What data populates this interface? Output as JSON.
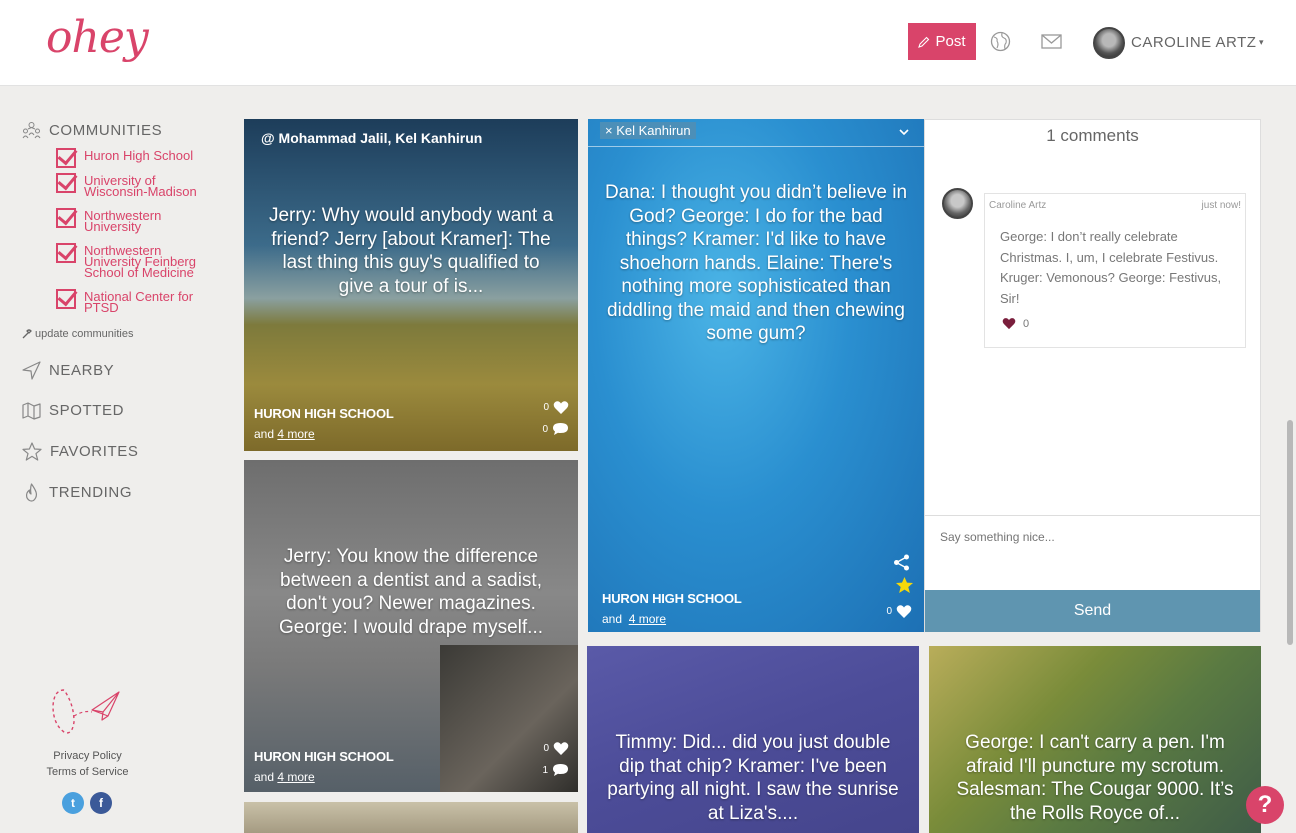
{
  "header": {
    "logo_text": "ohey",
    "post_label": "Post",
    "user_name": "CAROLINE ARTZ",
    "user_caret": "▾"
  },
  "sidebar": {
    "communities_label": "COMMUNITIES",
    "communities": [
      "Huron High School",
      "University of Wisconsin-Madison",
      "Northwestern University",
      "Northwestern University Feinberg School of Medicine",
      "National Center for PTSD"
    ],
    "update_label": "update communities",
    "nav": [
      "NEARBY",
      "SPOTTED",
      "FAVORITES",
      "TRENDING"
    ],
    "privacy_label": "Privacy Policy",
    "terms_label": "Terms of Service",
    "twitter_glyph": "t",
    "facebook_glyph": "f"
  },
  "cards": [
    {
      "mention": "@ Mohammad Jalil, Kel Kanhirun",
      "text": "Jerry: Why would anybody want a friend? Jerry [about Kramer]: The last thing this guy's qualified to give a tour of is...",
      "school": "HURON HIGH SCHOOL",
      "and_label": "and",
      "more_label": "4 more",
      "likes": "0",
      "comments": "0"
    },
    {
      "text": "Jerry: You know the difference between a dentist and a sadist, don't you? Newer magazines. George: I would drape myself...",
      "school": "HURON HIGH SCHOOL",
      "and_label": "and",
      "more_label": "4 more",
      "likes": "0",
      "comments": "1"
    },
    {
      "tag": "× Kel Kanhirun",
      "text": "Dana: I thought you didn’t believe in God? George: I do for the bad things? Kramer: I'd like to have shoehorn hands. Elaine: There's nothing more sophisticated than diddling the maid and then chewing some gum?",
      "school": "HURON HIGH SCHOOL",
      "and_label": "and",
      "more_label": "4 more",
      "likes": "0"
    },
    {
      "text": "Timmy: Did... did you just double dip that chip? Kramer: I've been partying all night. I saw the sunrise at Liza's...."
    },
    {
      "text": "George: I can't carry a pen. I'm afraid I'll puncture my scrotum. Salesman: The Cougar 9000. It’s the Rolls Royce of..."
    }
  ],
  "comments_panel": {
    "title": "1 comments",
    "comment": {
      "author": "Caroline Artz",
      "time": "just now!",
      "text": "George: I don’t really celebrate Christmas. I, um, I celebrate Festivus. Kruger: Vemonous? George: Festivus, Sir!",
      "likes": "0"
    },
    "input_placeholder": "Say something nice...",
    "send_label": "Send"
  },
  "help_label": "?",
  "colors": {
    "brand": "#d9446a",
    "send": "#5f95b0",
    "star": "#f5d90a"
  }
}
